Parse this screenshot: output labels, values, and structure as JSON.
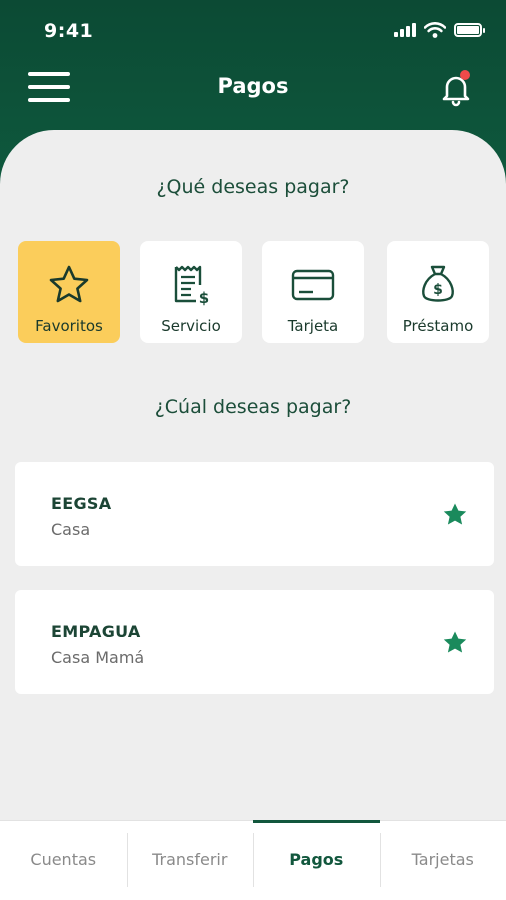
{
  "status": {
    "time": "9:41"
  },
  "header": {
    "title": "Pagos"
  },
  "section1": {
    "title": "¿Qué deseas pagar?"
  },
  "categories": [
    {
      "label": "Favoritos",
      "icon": "star-outline-icon",
      "selected": true
    },
    {
      "label": "Servicio",
      "icon": "receipt-dollar-icon",
      "selected": false
    },
    {
      "label": "Tarjeta",
      "icon": "credit-card-icon",
      "selected": false
    },
    {
      "label": "Préstamo",
      "icon": "money-bag-icon",
      "selected": false
    }
  ],
  "section2": {
    "title": "¿Cúal deseas pagar?"
  },
  "payees": [
    {
      "name": "EEGSA",
      "subtitle": "Casa",
      "favorite": true
    },
    {
      "name": "EMPAGUA",
      "subtitle": "Casa Mamá",
      "favorite": true
    }
  ],
  "tabs": [
    {
      "label": "Cuentas",
      "active": false
    },
    {
      "label": "Transferir",
      "active": false
    },
    {
      "label": "Pagos",
      "active": true
    },
    {
      "label": "Tarjetas",
      "active": false
    }
  ],
  "colors": {
    "header_green": "#0e5a3e",
    "accent_yellow": "#fbcd5b",
    "star_green": "#1a8a5c",
    "notification_red": "#ef4a4a",
    "sheet_bg": "#eeeeee"
  }
}
